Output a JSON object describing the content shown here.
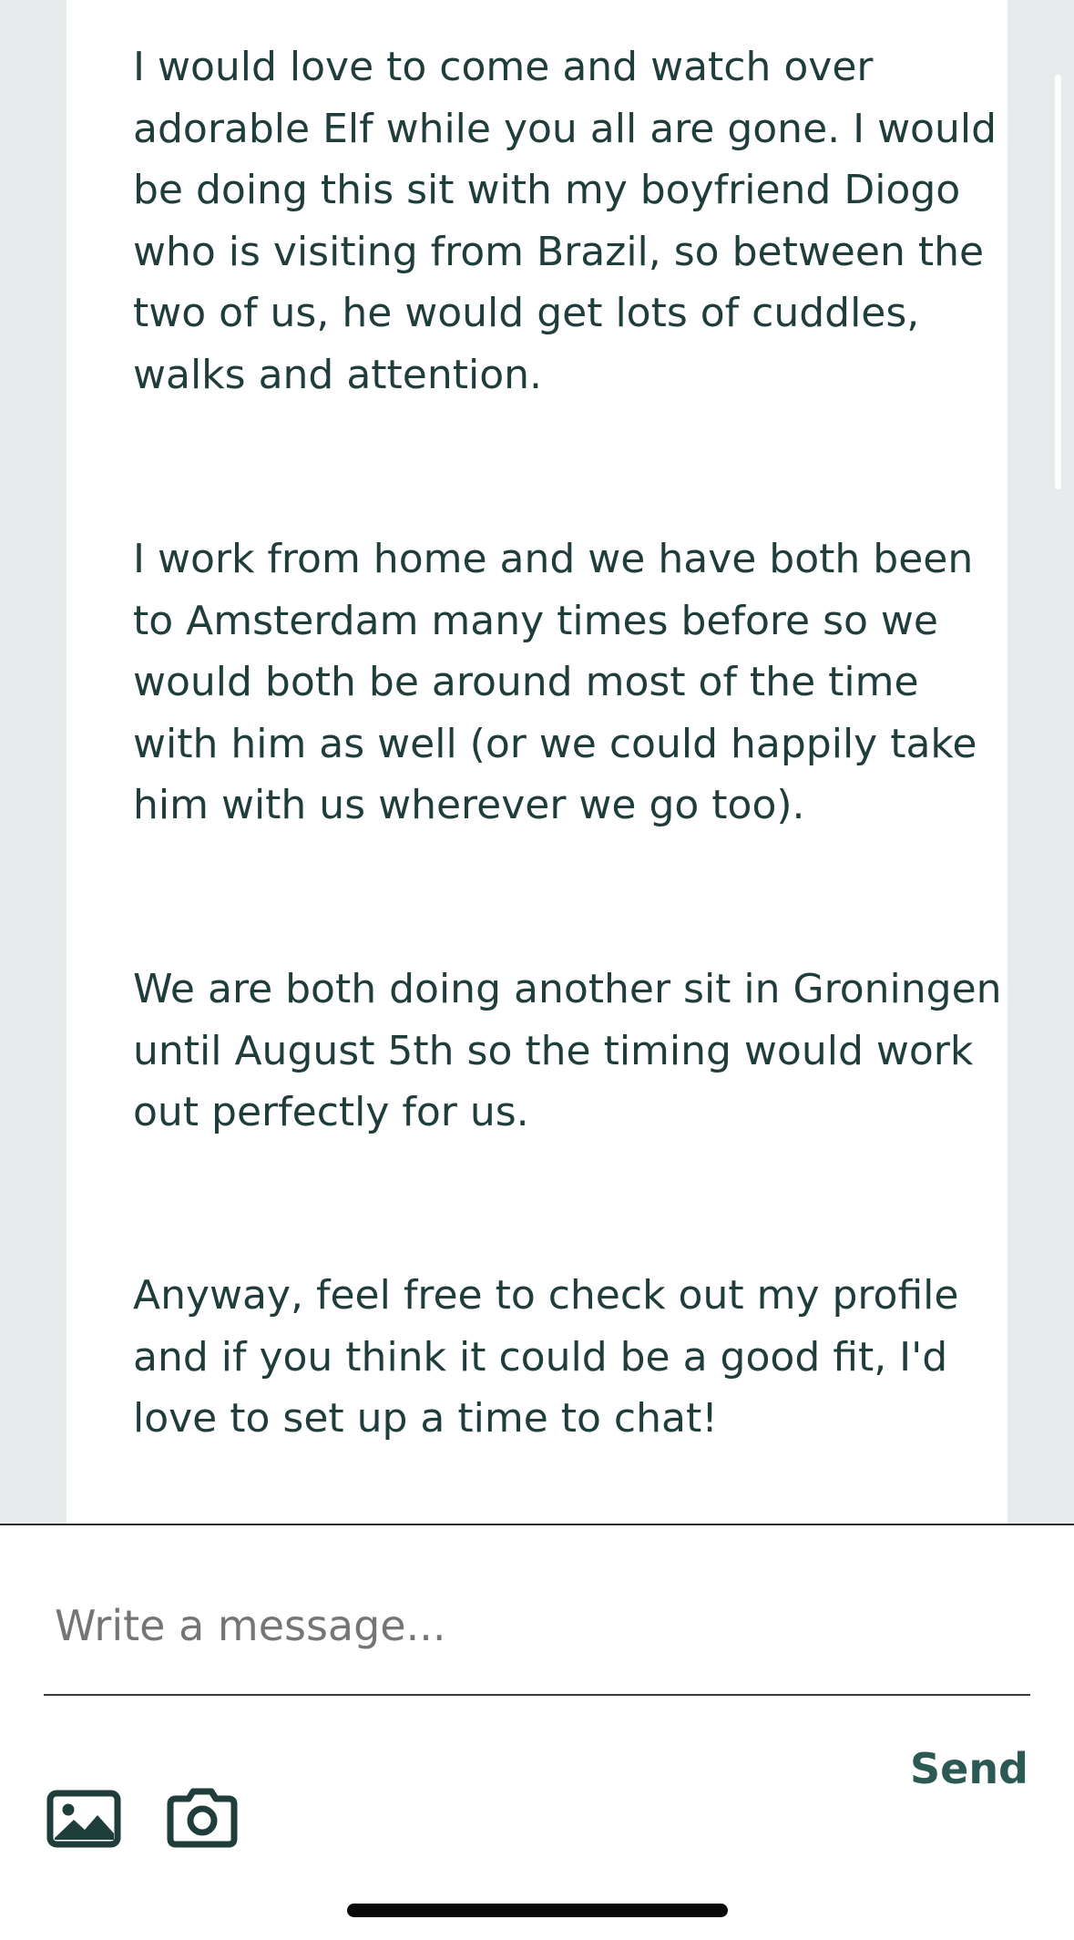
{
  "message": {
    "paragraphs": [
      "I would love to come and watch over adorable Elf while you all are gone. I would be doing this sit with my boyfriend Diogo who is visiting from Brazil, so between the two of us, he would get lots of cuddles, walks and attention.",
      "I work from home and we have both been to Amsterdam many times before so we would both be around most of the time with him as well (or we could happily take him with us wherever we go too).",
      "We are both doing another sit in Groningen until August 5th so the timing would work out perfectly for us.",
      "Anyway, feel free to check out my profile and if you think it could be a good fit, I'd love to set up a time to chat!"
    ]
  },
  "composer": {
    "placeholder": "Write a message...",
    "value": "",
    "send_label": "Send",
    "icons": {
      "image": "image-icon",
      "camera": "camera-icon"
    }
  },
  "colors": {
    "text": "#1f3d3a",
    "accent": "#2b5a55",
    "chat_background": "#e8ebeb",
    "bubble_background": "#ffffff"
  }
}
